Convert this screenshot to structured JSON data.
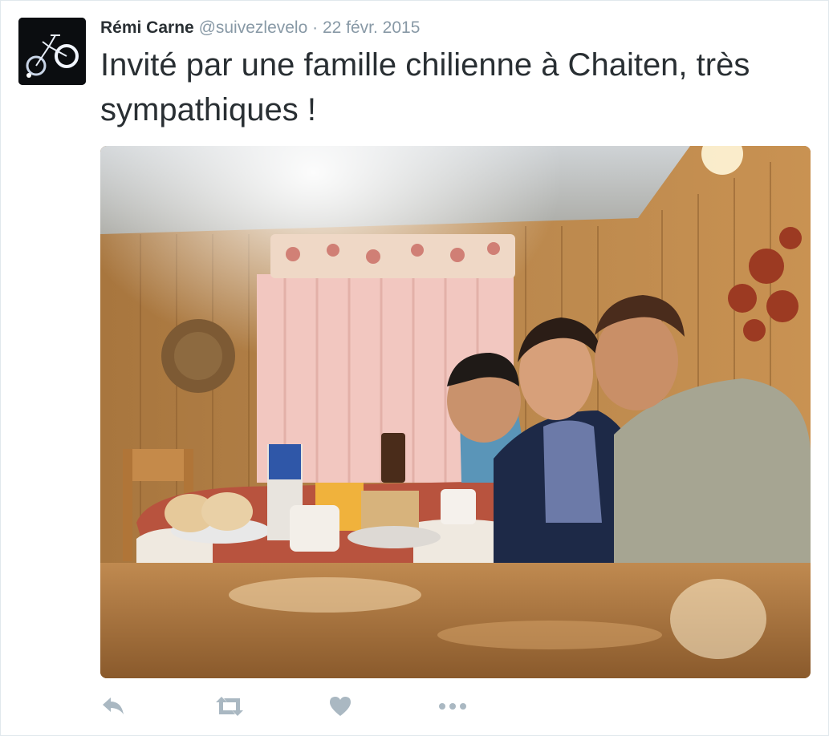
{
  "tweet": {
    "fullname": "Rémi Carne",
    "username": "@suivezlevelo",
    "separator": "·",
    "timestamp": "22 févr. 2015",
    "text": "Invité par une famille chilienne à Chaiten, très sympathiques !"
  },
  "avatar": {
    "icon": "bicycle-icon",
    "description_alt": "profile picture"
  },
  "media": {
    "alt": "photo"
  },
  "actions": [
    {
      "name": "reply",
      "icon": "reply-icon"
    },
    {
      "name": "retweet",
      "icon": "retweet-icon"
    },
    {
      "name": "like",
      "icon": "heart-icon"
    },
    {
      "name": "more",
      "icon": "more-icon"
    }
  ],
  "colors": {
    "text_primary": "#292f33",
    "text_secondary": "#8899a6",
    "action_icon": "#aab8c2",
    "border": "#e1e8ed"
  }
}
